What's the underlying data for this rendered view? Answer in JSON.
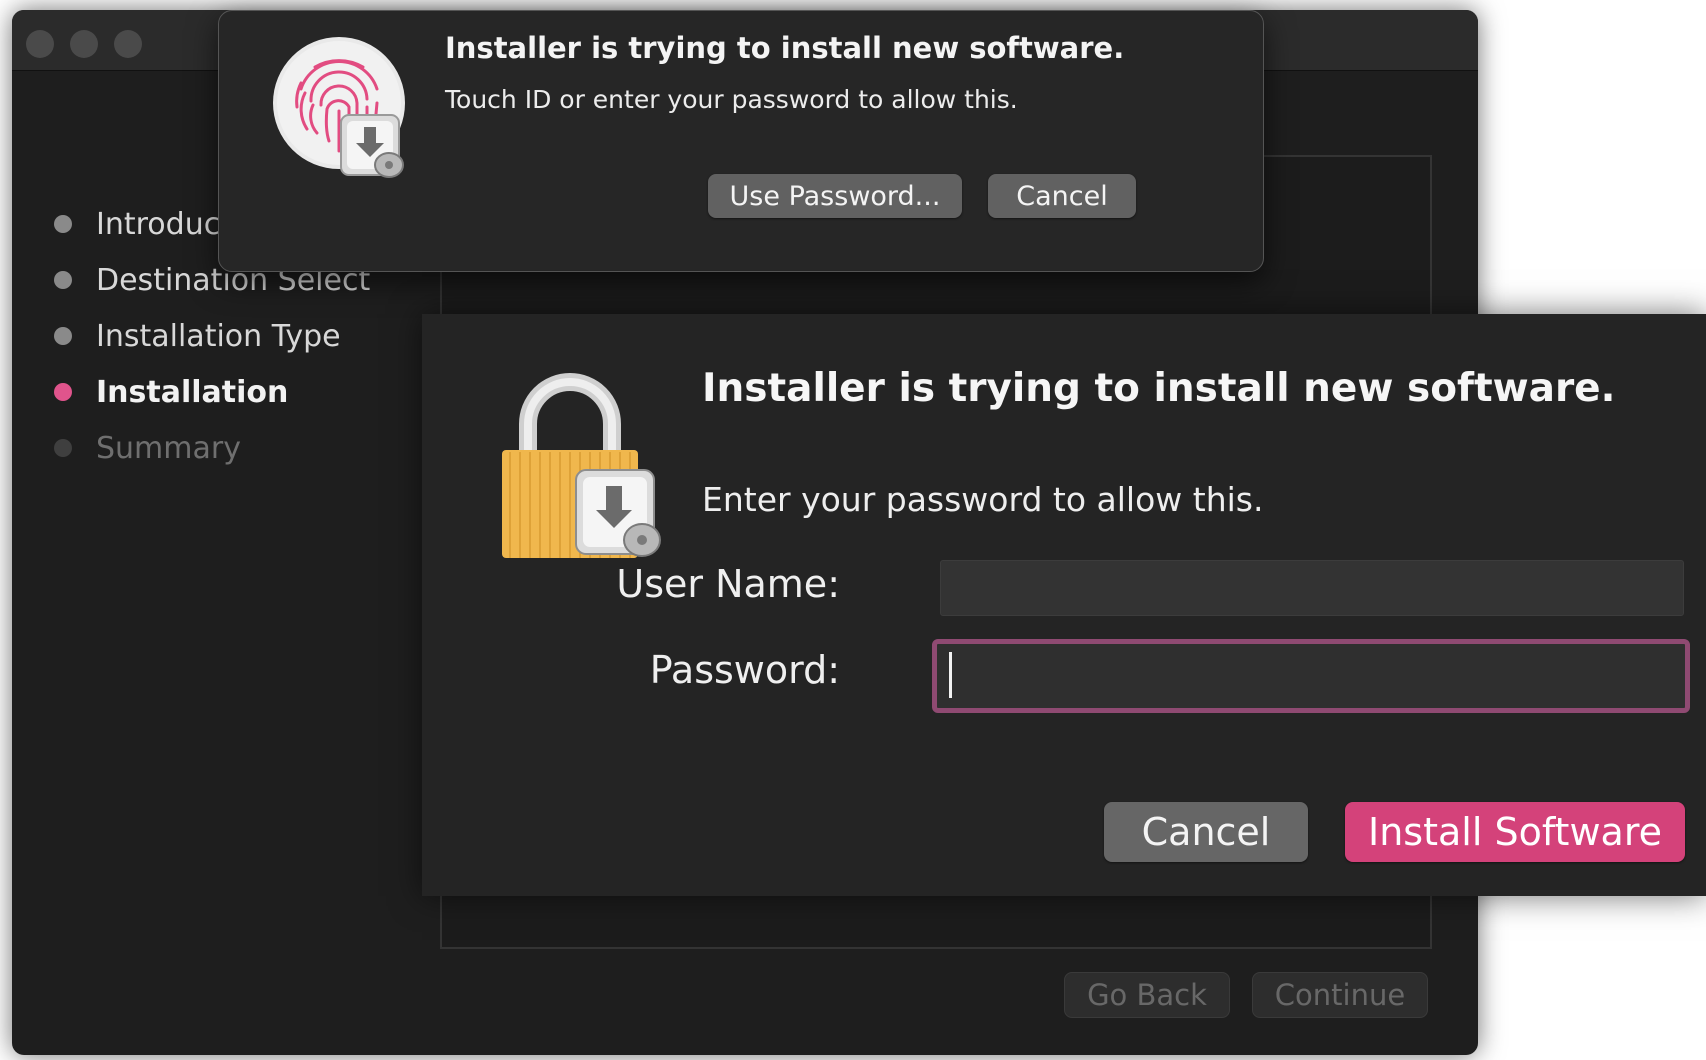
{
  "sidebar": {
    "steps": [
      {
        "label": "Introduc",
        "state": "done"
      },
      {
        "label": "Destination Select",
        "state": "done"
      },
      {
        "label": "Installation Type",
        "state": "done"
      },
      {
        "label": "Installation",
        "state": "active"
      },
      {
        "label": "Summary",
        "state": "pending"
      }
    ]
  },
  "nav": {
    "back_label": "Go Back",
    "continue_label": "Continue"
  },
  "touchid_dialog": {
    "title": "Installer is trying to install new software.",
    "message": "Touch ID or enter your password to allow this.",
    "use_password_label": "Use Password...",
    "cancel_label": "Cancel",
    "icon": "touch-id-fingerprint-icon"
  },
  "password_dialog": {
    "title": "Installer is trying to install new software.",
    "message": "Enter your password to allow this.",
    "username_label": "User Name:",
    "username_value": "",
    "password_label": "Password:",
    "password_value": "",
    "cancel_label": "Cancel",
    "install_label": "Install Software",
    "icon": "lock-icon"
  },
  "colors": {
    "accent": "#d4427a",
    "window_bg": "#1e1e1e",
    "dialog_bg": "#242424"
  }
}
